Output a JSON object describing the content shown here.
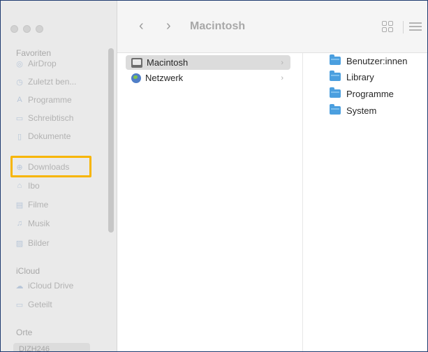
{
  "sidebar": {
    "sections": {
      "favorites": "Favoriten",
      "icloud": "iCloud",
      "locations": "Orte"
    },
    "favorites": [
      {
        "label": "AirDrop",
        "icon": "airdrop-icon"
      },
      {
        "label": "Zuletzt ben...",
        "icon": "clock-icon"
      },
      {
        "label": "Programme",
        "icon": "apps-icon"
      },
      {
        "label": "Schreibtisch",
        "icon": "desktop-icon"
      },
      {
        "label": "Dokumente",
        "icon": "document-icon"
      },
      {
        "label": "Downloads",
        "icon": "download-icon"
      },
      {
        "label": "Ibo",
        "icon": "home-icon"
      },
      {
        "label": "Filme",
        "icon": "film-icon"
      },
      {
        "label": "Musik",
        "icon": "music-icon"
      },
      {
        "label": "Bilder",
        "icon": "photo-icon"
      }
    ],
    "icloud": [
      {
        "label": "iCloud Drive",
        "icon": "cloud-icon"
      },
      {
        "label": "Geteilt",
        "icon": "shared-folder-icon"
      }
    ],
    "locations": [
      {
        "label": "DIZH246",
        "icon": "computer-icon"
      }
    ]
  },
  "toolbar": {
    "title": "Macintosh",
    "back": "‹",
    "forward": "›"
  },
  "column1": [
    {
      "label": "Macintosh",
      "selected": true,
      "icon": "drive-icon"
    },
    {
      "label": "Netzwerk",
      "selected": false,
      "icon": "network-globe-icon"
    }
  ],
  "column2": [
    {
      "label": "Benutzer:innen"
    },
    {
      "label": "Library"
    },
    {
      "label": "Programme"
    },
    {
      "label": "System"
    }
  ],
  "colors": {
    "highlight": "#f7b500",
    "folder": "#4b9fdf"
  }
}
